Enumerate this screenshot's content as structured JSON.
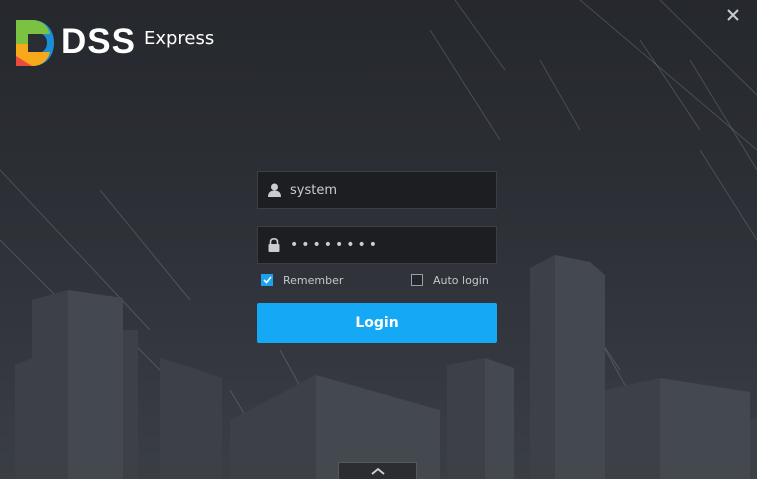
{
  "app": {
    "logo_text": "DSS",
    "logo_subtitle": "Express"
  },
  "login_form": {
    "username": {
      "value": "system",
      "icon": "user-icon"
    },
    "password": {
      "masked_value": "••••••••",
      "icon": "lock-icon"
    },
    "remember": {
      "label": "Remember",
      "checked": true
    },
    "auto_login": {
      "label": "Auto login",
      "checked": false
    },
    "login_label": "Login"
  },
  "window": {
    "close_icon": "close-icon",
    "expand_icon": "chevron-up-icon"
  },
  "colors": {
    "accent": "#14a8f5",
    "checkbox_on": "#1aa1f2",
    "background": "#2a2d33",
    "field_bg": "#1c1e22"
  }
}
